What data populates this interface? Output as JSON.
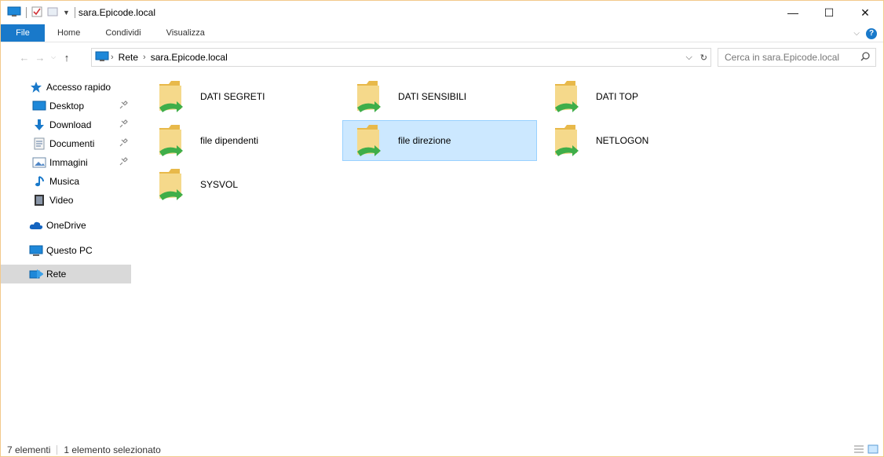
{
  "window": {
    "title": "sara.Epicode.local"
  },
  "window_controls": {
    "minimize": "—",
    "maximize": "☐",
    "close": "✕"
  },
  "ribbon": {
    "tabs": [
      {
        "label": "File"
      },
      {
        "label": "Home"
      },
      {
        "label": "Condividi"
      },
      {
        "label": "Visualizza"
      }
    ],
    "help": "?"
  },
  "address": {
    "breadcrumbs": [
      "Rete",
      "sara.Epicode.local"
    ]
  },
  "search": {
    "placeholder": "Cerca in sara.Epicode.local"
  },
  "nav": {
    "items": [
      {
        "label": "Accesso rapido",
        "icon": "star-icon"
      },
      {
        "label": "Desktop",
        "icon": "desktop-icon"
      },
      {
        "label": "Download",
        "icon": "download-icon"
      },
      {
        "label": "Documenti",
        "icon": "documents-icon"
      },
      {
        "label": "Immagini",
        "icon": "pictures-icon"
      },
      {
        "label": "Musica",
        "icon": "music-icon"
      },
      {
        "label": "Video",
        "icon": "video-icon"
      },
      {
        "label": "OneDrive",
        "icon": "cloud-icon"
      },
      {
        "label": "Questo PC",
        "icon": "computer-icon"
      },
      {
        "label": "Rete",
        "icon": "network-icon"
      }
    ]
  },
  "folders": [
    {
      "label": "DATI SEGRETI"
    },
    {
      "label": "DATI SENSIBILI"
    },
    {
      "label": "DATI TOP"
    },
    {
      "label": "file dipendenti"
    },
    {
      "label": "file direzione"
    },
    {
      "label": "NETLOGON"
    },
    {
      "label": "SYSVOL"
    }
  ],
  "status": {
    "count": "7 elementi",
    "selection": "1 elemento selezionato"
  },
  "colors": {
    "accent": "#1979ca",
    "selection": "#cce8ff",
    "window_border": "#f3c98b",
    "folder": "#f5d98b",
    "share_arrow": "#3fae49"
  }
}
